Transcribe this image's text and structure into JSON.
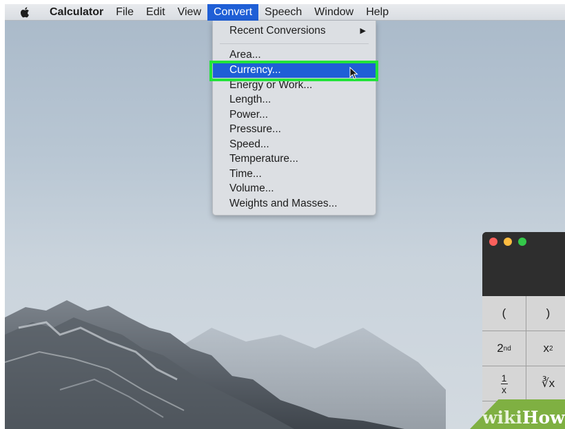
{
  "menubar": {
    "apple_icon": "apple-logo-icon",
    "items": [
      {
        "label": "Calculator"
      },
      {
        "label": "File"
      },
      {
        "label": "Edit"
      },
      {
        "label": "View"
      },
      {
        "label": "Convert"
      },
      {
        "label": "Speech"
      },
      {
        "label": "Window"
      },
      {
        "label": "Help"
      }
    ],
    "active": "Convert"
  },
  "convert_menu": {
    "recent": {
      "label": "Recent Conversions",
      "submenu_icon": "submenu-arrow-icon",
      "arrow": "▶"
    },
    "items": [
      {
        "label": "Area..."
      },
      {
        "label": "Currency..."
      },
      {
        "label": "Energy or Work..."
      },
      {
        "label": "Length..."
      },
      {
        "label": "Power..."
      },
      {
        "label": "Pressure..."
      },
      {
        "label": "Speed..."
      },
      {
        "label": "Temperature..."
      },
      {
        "label": "Time..."
      },
      {
        "label": "Volume..."
      },
      {
        "label": "Weights and Masses..."
      }
    ],
    "highlighted": "Currency...",
    "highlight_color": "#1f5fd6",
    "callout_color": "#22e33a"
  },
  "calculator": {
    "traffic_lights": {
      "close": "#fc605c",
      "minimize": "#fdbc40",
      "zoom": "#34c84a"
    },
    "keys": {
      "open_paren": "(",
      "close_paren": ")",
      "second_base": "2",
      "second_sup": "nd",
      "square_base": "x",
      "square_sup": "2",
      "reciprocal_num": "1",
      "reciprocal_den": "x",
      "cube_root": "∛x"
    }
  },
  "watermark": {
    "part1": "wiki",
    "part2": "How"
  }
}
